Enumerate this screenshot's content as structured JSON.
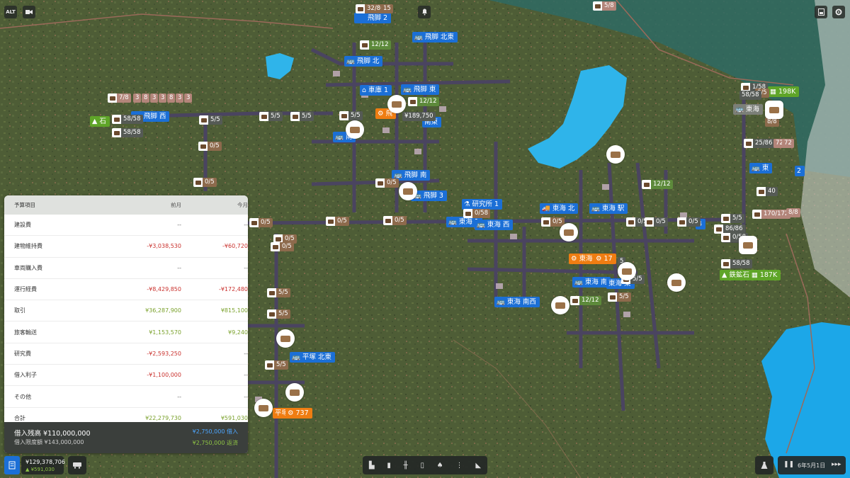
{
  "toolbar_top_left": {
    "alt_label": "ALT",
    "camera_icon": "video-camera-icon"
  },
  "top_right": {
    "save_icon": "save-icon",
    "settings_icon": "gear-icon"
  },
  "stations": [
    {
      "label": "飛脚 2",
      "color": "blue"
    },
    {
      "label": "飛脚 北東",
      "color": "blue"
    },
    {
      "label": "飛脚 北",
      "color": "blue"
    },
    {
      "label": "車庫 1",
      "color": "blue"
    },
    {
      "label": "飛脚 東",
      "color": "blue"
    },
    {
      "label": "飛脚 西",
      "color": "blue"
    },
    {
      "label": "石",
      "color": "green"
    },
    {
      "label": "飛",
      "color": "orange"
    },
    {
      "label": "南東",
      "color": "blue"
    },
    {
      "label": "南",
      "color": "blue"
    },
    {
      "label": "飛脚 南",
      "color": "blue"
    },
    {
      "label": "飛脚 3",
      "color": "blue"
    },
    {
      "label": "研究所 1",
      "color": "blue"
    },
    {
      "label": "東海 1",
      "color": "blue"
    },
    {
      "label": "東海 西",
      "color": "blue"
    },
    {
      "label": "東海 北",
      "color": "blue"
    },
    {
      "label": "東海 駅",
      "color": "blue"
    },
    {
      "label": "東海",
      "color": "orange"
    },
    {
      "label": "17",
      "color": "orange"
    },
    {
      "label": "東海 南",
      "color": "blue"
    },
    {
      "label": "東海 東",
      "color": "blue"
    },
    {
      "label": "東海 南西",
      "color": "blue"
    },
    {
      "label": "平塚 北東",
      "color": "blue"
    },
    {
      "label": "平塚",
      "color": "orange"
    },
    {
      "label": "737",
      "color": "orange"
    },
    {
      "label": "東",
      "color": "blue"
    },
    {
      "label": "2",
      "color": "blue"
    },
    {
      "label": "4",
      "color": "blue"
    },
    {
      "label": "東海",
      "color": "gray"
    }
  ],
  "resources": [
    {
      "label": "鉄鉱石",
      "value": "187K"
    },
    {
      "label": "198K"
    }
  ],
  "counters": [
    "32/86",
    "15",
    "12/12",
    "7/8",
    "3",
    "8",
    "3",
    "3",
    "8",
    "3",
    "3",
    "5/8",
    "58/58",
    "5/5",
    "5/5",
    "5/5",
    "5/5",
    "12/12",
    "¥189,750",
    "0/5",
    "0/5",
    "0/5",
    "0/5",
    "0/5",
    "0/58",
    "0/5",
    "0/5",
    "0/5",
    "0/5",
    "0/5",
    "0/5",
    "0/5",
    "5/5",
    "5/5",
    "5/5",
    "5/5",
    "5/5",
    "12/12",
    "12/12",
    "5/5",
    "1/58",
    "25/86",
    "72",
    "72",
    "40",
    "170/172",
    "8/8",
    "5/5",
    "86/86",
    "0/58",
    "58/58",
    "8/8",
    "0/5",
    "58/58",
    "5"
  ],
  "budget": {
    "headers": {
      "item": "予算項目",
      "prev": "前月",
      "curr": "今月"
    },
    "rows": [
      {
        "item": "建設費",
        "prev": "--",
        "curr": "--",
        "prev_type": "dash",
        "curr_type": "dash"
      },
      {
        "item": "建物維持費",
        "prev": "-¥3,038,530",
        "curr": "-¥60,720",
        "prev_type": "red",
        "curr_type": "red"
      },
      {
        "item": "車両購入費",
        "prev": "--",
        "curr": "--",
        "prev_type": "dash",
        "curr_type": "dash"
      },
      {
        "item": "運行経費",
        "prev": "-¥8,429,850",
        "curr": "-¥172,480",
        "prev_type": "red",
        "curr_type": "red"
      },
      {
        "item": "取引",
        "prev": "¥36,287,900",
        "curr": "¥815,100",
        "prev_type": "grn",
        "curr_type": "grn"
      },
      {
        "item": "旅客輸送",
        "prev": "¥1,153,570",
        "curr": "¥9,240",
        "prev_type": "grn",
        "curr_type": "grn"
      },
      {
        "item": "研究費",
        "prev": "-¥2,593,250",
        "curr": "--",
        "prev_type": "red",
        "curr_type": "dash"
      },
      {
        "item": "借入利子",
        "prev": "-¥1,100,000",
        "curr": "--",
        "prev_type": "red",
        "curr_type": "dash"
      },
      {
        "item": "その他",
        "prev": "--",
        "curr": "--",
        "prev_type": "dash",
        "curr_type": "dash"
      },
      {
        "item": "合計",
        "prev": "¥22,279,730",
        "curr": "¥591,030",
        "prev_type": "grn",
        "curr_type": "grn"
      }
    ],
    "loan_balance": "借入残高 ¥110,000,000",
    "loan_limit": "借入限度額 ¥143,000,000",
    "borrow_link": "¥2,750,000 借入",
    "repay_link": "¥2,750,000 返済"
  },
  "bottom_left": {
    "money": "¥129,378,706",
    "delta": "▲ ¥591,030"
  },
  "bottom_center_icons": [
    "chart-icon",
    "info-icon",
    "rail-icon",
    "train-icon",
    "tree-icon",
    "more-icon",
    "bulldozer-icon"
  ],
  "bottom_right": {
    "date": "6年5月1日",
    "pause_icon": "pause-icon",
    "speed_icon": "fast-forward-icon",
    "research_icon": "flask-icon"
  },
  "colors": {
    "station_blue": "#1b6fd6",
    "station_orange": "#ef7d12",
    "station_green": "#5fa528",
    "expense_red": "#c9302c",
    "income_green": "#7aa12b",
    "panel_dark": "#3b3f3c"
  }
}
